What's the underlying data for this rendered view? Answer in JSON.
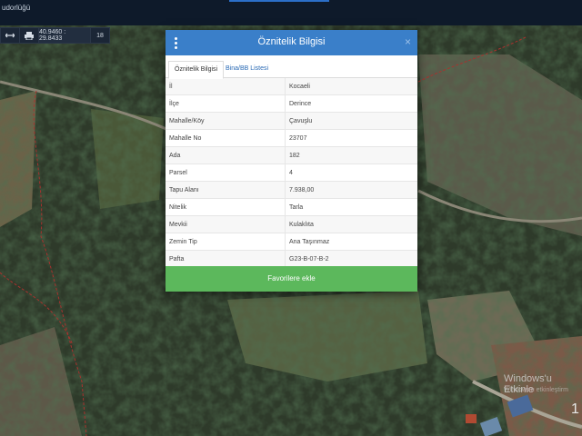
{
  "header": {
    "org": "udorlüğü"
  },
  "toolbar": {
    "coords": "40.9460 : 29.8433",
    "zoom": "18"
  },
  "modal": {
    "title": "Öznitelik Bilgisi",
    "close": "×",
    "tabs": [
      "Öznitelik Bilgisi",
      "Bina/BB Listesi"
    ],
    "rows": [
      {
        "key": "İl",
        "value": "Kocaeli"
      },
      {
        "key": "İlçe",
        "value": "Derince"
      },
      {
        "key": "Mahalle/Köy",
        "value": "Çavuşlu"
      },
      {
        "key": "Mahalle No",
        "value": "23707"
      },
      {
        "key": "Ada",
        "value": "182"
      },
      {
        "key": "Parsel",
        "value": "4"
      },
      {
        "key": "Tapu Alanı",
        "value": "7.938,00"
      },
      {
        "key": "Nitelik",
        "value": "Tarla"
      },
      {
        "key": "Mevkii",
        "value": "Kulaklıta"
      },
      {
        "key": "Zemin Tip",
        "value": "Ana Taşınmaz"
      },
      {
        "key": "Pafta",
        "value": "G23-B-07-B-2"
      }
    ],
    "action": "Favorilere ekle"
  },
  "watermark": {
    "line1": "Windows'u Etkinle",
    "line2": "Windows'u etkinleştirm"
  },
  "page_number": "1",
  "colors": {
    "header_blue": "#3a7fc9",
    "button_green": "#5cb85c",
    "parcel_line": "#a8322e"
  }
}
